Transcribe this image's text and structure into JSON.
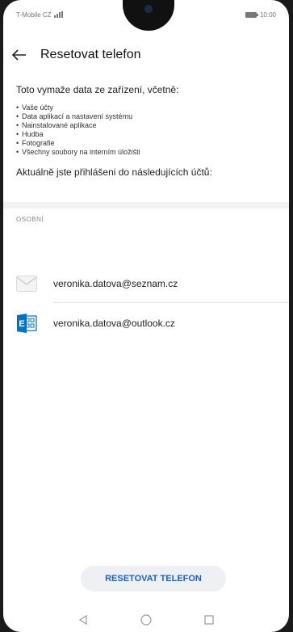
{
  "status_bar": {
    "carrier": "T-Mobile CZ",
    "time": "10:00"
  },
  "app_bar": {
    "title": "Resetovat telefon"
  },
  "content": {
    "lead": "Toto vymaže data ze zařízení, včetně:",
    "items": [
      "Vaše účty",
      "Data aplikací a nastavení systému",
      "Nainstalované aplikace",
      "Hudba",
      "Fotografie",
      "Všechny soubory na interním úložišti"
    ],
    "logged_in": "Aktuálně jste přihlášeni do následujících účtů:"
  },
  "accounts_section": {
    "label": "OSOBNÍ",
    "accounts": [
      {
        "email": "veronika.datova@seznam.cz",
        "icon": "mail-envelope-icon"
      },
      {
        "email": "veronika.datova@outlook.cz",
        "icon": "exchange-icon"
      }
    ]
  },
  "action": {
    "reset_label": "RESETOVAT TELEFON"
  },
  "colors": {
    "accent": "#1f5fd0",
    "exchange": "#0072c6"
  }
}
